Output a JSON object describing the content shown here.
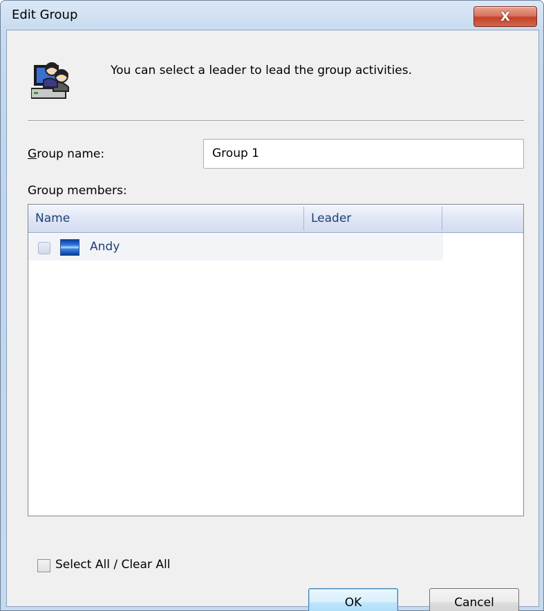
{
  "window": {
    "title": "Edit Group",
    "close_glyph": "X"
  },
  "header": {
    "icon": "users-computer-icon",
    "message": "You can select a leader to lead the group activities."
  },
  "group_name": {
    "label_accel": "G",
    "label_rest": "roup name:",
    "value": "Group 1"
  },
  "members": {
    "label": "Group members:",
    "columns": [
      "Name",
      "Leader"
    ],
    "rows": [
      {
        "name": "Andy",
        "leader": "",
        "checked": false
      }
    ]
  },
  "select_all": {
    "label": "Select All / Clear All",
    "checked": false
  },
  "buttons": {
    "ok": "OK",
    "cancel": "Cancel"
  }
}
